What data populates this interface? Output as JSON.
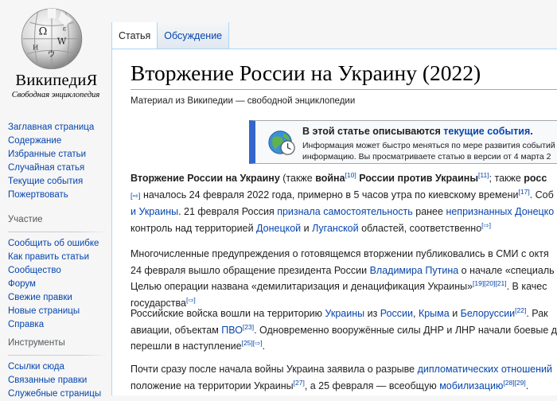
{
  "logo": {
    "wordmark": "ВикипедиЯ",
    "tagline": "Свободная энциклопедия"
  },
  "nav": {
    "main": [
      "Заглавная страница",
      "Содержание",
      "Избранные статьи",
      "Случайная статья",
      "Текущие события",
      "Пожертвовать"
    ],
    "participation_heading": "Участие",
    "participation": [
      "Сообщить об ошибке",
      "Как править статьи",
      "Сообщество",
      "Форум",
      "Свежие правки",
      "Новые страницы",
      "Справка"
    ],
    "tools_heading": "Инструменты",
    "tools": [
      "Ссылки сюда",
      "Связанные правки",
      "Служебные страницы"
    ]
  },
  "tabs": {
    "article": "Статья",
    "talk": "Обсуждение"
  },
  "article": {
    "title": "Вторжение России на Украину (2022)",
    "site_sub": "Материал из Википедии — свободной энциклопедии",
    "notice": {
      "title_prefix": "В этой статье описываются ",
      "title_link": "текущие события",
      "title_suffix": ".",
      "line1": "Информация может быстро меняться по мере развития событий",
      "line2": "информацию. Вы просматриваете статью в версии от 4 марта 2"
    },
    "p1": {
      "l1_bold1": "Вторжение России на Украину",
      "l1_t1": " (также ",
      "l1_bold2": "война",
      "l1_ref1": "[10]",
      "l1_bold3": " России против Украины",
      "l1_ref2": "[11]",
      "l1_t2": "; также ",
      "l1_bold4": "росс",
      "l2_ext": "[⇨]",
      "l2_t1": " началось 24 февраля 2022 года, примерно в 5 часов утра по киевскому времени",
      "l2_ref": "[17]",
      "l2_t2": ". Соб",
      "l3_link1": "и Украины",
      "l3_t1": ". 21 февраля Россия ",
      "l3_link2": "признала самостоятельность",
      "l3_t2": " ранее ",
      "l3_link3": "непризнанных Донецко",
      "l4_t1": "контроль над территорией ",
      "l4_link1": "Донецкой",
      "l4_t2": " и ",
      "l4_link2": "Луганской",
      "l4_t3": " областей, соответственно",
      "l4_ext": "[⇨]"
    },
    "p2": {
      "l1": "Многочисленные предупреждения о готовящемся вторжении публиковались в СМИ с октя",
      "l2_t1": "24 февраля вышло обращение президента России ",
      "l2_link": "Владимира Путина",
      "l2_t2": " о начале «специаль",
      "l3_t1": "Целью операции названа «демилитаризация и денацификация Украины»",
      "l3_refs": "[19][20][21]",
      "l3_t2": ". В качес",
      "l4_t1": "государства",
      "l4_ext": "[⇨]"
    },
    "p3": {
      "l1_t1": "Российские войска вошли на территорию ",
      "l1_link1": "Украины",
      "l1_t2": " из ",
      "l1_link2": "России",
      "l1_t3": ", ",
      "l1_link3": "Крыма",
      "l1_t4": " и ",
      "l1_link4": "Белоруссии",
      "l1_ref": "[22]",
      "l1_t5": ". Рак",
      "l2_t1": "авиации, объектам ",
      "l2_link": "ПВО",
      "l2_ref": "[23]",
      "l2_t2": ". Одновременно вооружённые силы ДНР и ЛНР начали боевые д",
      "l3_t1": "перешли в наступление",
      "l3_ref": "[25]",
      "l3_ext": "[⇨]",
      "l3_t2": "."
    },
    "p4": {
      "l1_t1": "Почти сразу после начала войны Украина заявила о разрыве ",
      "l1_link": "дипломатических отношений",
      "l2_t1": "положение на территории Украины",
      "l2_ref1": "[27]",
      "l2_t2": ", а 25 февраля — всеобщую ",
      "l2_link": "мобилизацию",
      "l2_refs": "[28][29]",
      "l2_t3": ". "
    }
  }
}
